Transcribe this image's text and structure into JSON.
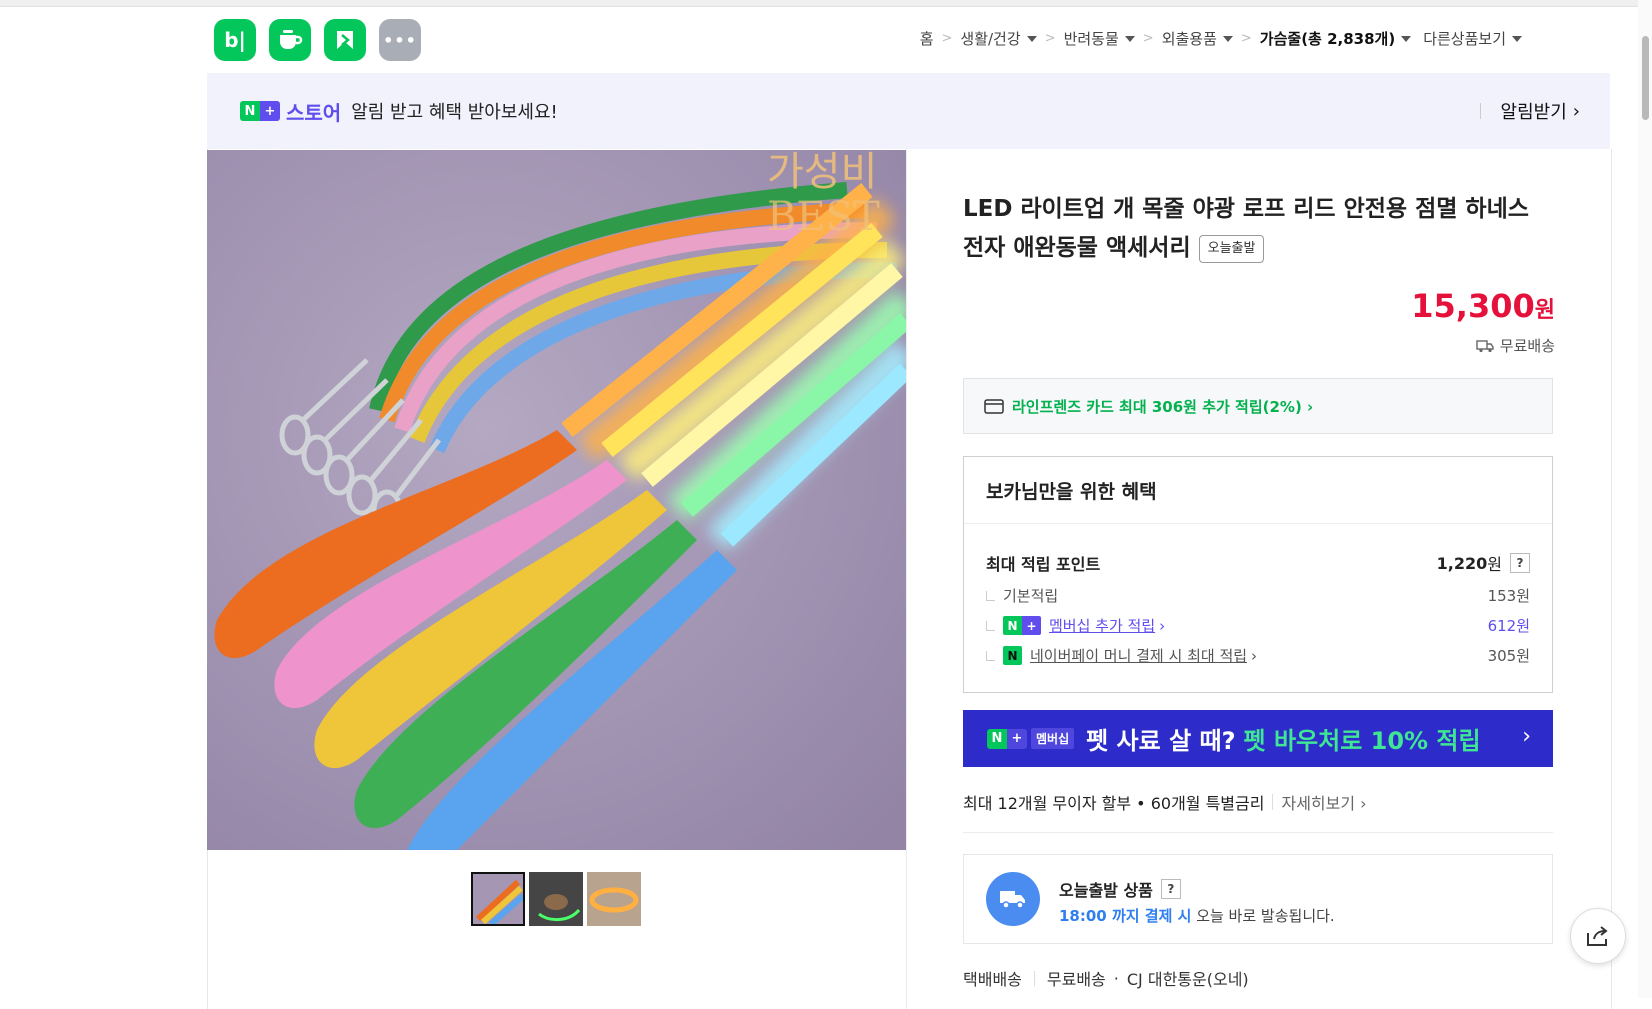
{
  "header": {
    "app_icons": [
      {
        "name": "blog-app",
        "label": "b|"
      },
      {
        "name": "cafe-app"
      },
      {
        "name": "kin-app"
      },
      {
        "name": "more-apps",
        "label": "•••"
      }
    ],
    "breadcrumbs": [
      {
        "label": "홈",
        "dropdown": false
      },
      {
        "label": "생활/건강",
        "dropdown": true
      },
      {
        "label": "반려동물",
        "dropdown": true
      },
      {
        "label": "외출용품",
        "dropdown": true
      },
      {
        "label": "가슴줄(총 2,838개)",
        "dropdown": true
      },
      {
        "label": "다른상품보기",
        "dropdown": true
      }
    ]
  },
  "banner": {
    "brand_n": "N",
    "brand_plus": "+",
    "store_label": "스토어",
    "text": "알림 받고 혜택 받아보세요!",
    "action": "알림받기",
    "action_arrow": "›"
  },
  "gallery": {
    "watermark_line1": "가성비",
    "watermark_line2": "BEST",
    "thumbnails": [
      "thumb-1",
      "thumb-2",
      "thumb-3"
    ],
    "active_index": 0
  },
  "product": {
    "title": "LED 라이트업 개 목줄 야광 로프 리드 안전용 점멸 하네스 전자 애완동물 액세서리",
    "badge": "오늘출발",
    "price": "15,300",
    "price_unit": "원",
    "delivery_fee": "무료배송"
  },
  "card_promo": {
    "text": "라인프렌즈 카드 최대 306원 추가 적립(2%) ›"
  },
  "benefit": {
    "title": "보카님만을 위한 혜택",
    "max_points_label": "최대 적립 포인트",
    "max_points_value": "1,220",
    "won": "원",
    "help": "?",
    "rows": [
      {
        "label": "기본적립",
        "value": "153원"
      },
      {
        "label": "멤버십 추가 적립",
        "value": "612원"
      },
      {
        "label": "네이버페이 머니 결제 시 최대 적립",
        "value": "305원"
      }
    ],
    "arrow": "›"
  },
  "membership_banner": {
    "membership_tag": "멤버십",
    "text": "펫 사료 살 때?",
    "highlight": "펫 바우처로 10% 적립",
    "arrow": "›"
  },
  "installment": {
    "text": "최대 12개월 무이자 할부 • 60개월 특별금리",
    "more": "자세히보기 ›"
  },
  "today_ship": {
    "title": "오늘출발 상품",
    "help": "?",
    "cutoff": "18:00 까지 결제 시",
    "rest": " 오늘 바로 발송됩니다."
  },
  "shipping": {
    "method": "택배배송",
    "fee": "무료배송",
    "dot": "·",
    "carrier": "CJ 대한통운(오네)"
  },
  "colors": {
    "naver_green": "#03c75a",
    "naver_purple": "#5f4dee",
    "price_red": "#e5113a",
    "promo_navy": "#2d2bca",
    "promo_green": "#3fe694",
    "link_blue": "#2f7ff0"
  }
}
